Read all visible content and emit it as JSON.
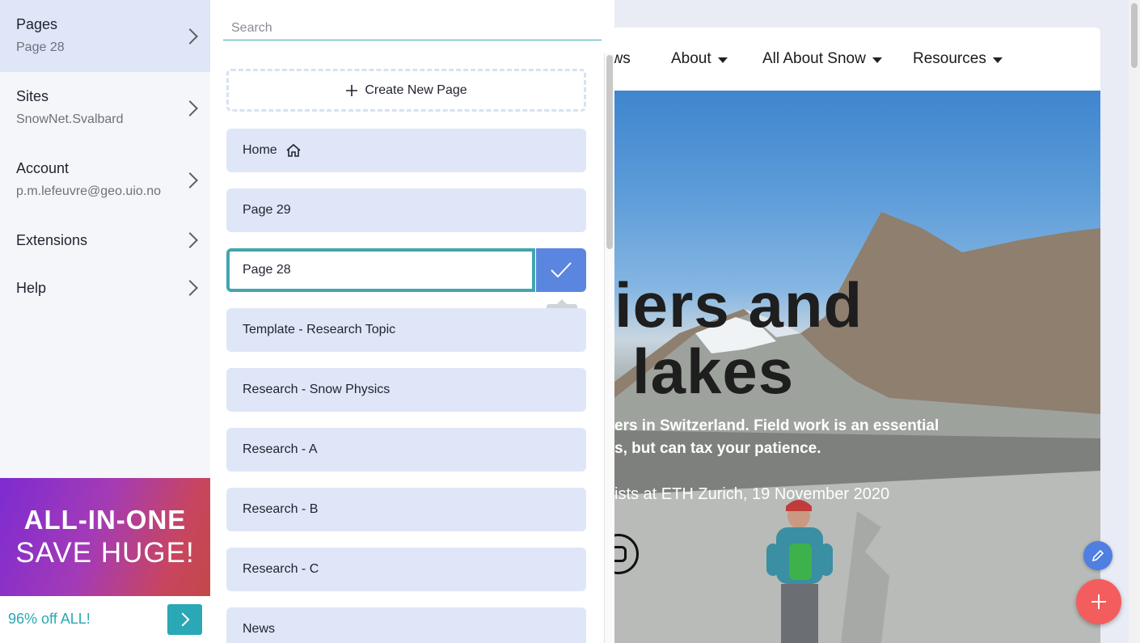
{
  "site": {
    "nav": [
      {
        "label": "ews"
      },
      {
        "label": "About"
      },
      {
        "label": "All About Snow"
      },
      {
        "label": "Resources"
      }
    ],
    "hero": {
      "title_line1": "iers and",
      "title_line2": "lakes",
      "subtitle_line1": "ers in Switzerland. Field work is an essential",
      "subtitle_line2": "s, but can tax your patience.",
      "credit": "ists at ETH Zurich, 19 November 2020"
    }
  },
  "left_nav": {
    "items": [
      {
        "title": "Pages",
        "subtitle": "Page 28"
      },
      {
        "title": "Sites",
        "subtitle": "SnowNet.Svalbard"
      },
      {
        "title": "Account",
        "subtitle": "p.m.lefeuvre@geo.uio.no"
      },
      {
        "title": "Extensions",
        "subtitle": ""
      },
      {
        "title": "Help",
        "subtitle": ""
      }
    ]
  },
  "ad": {
    "line1": "ALL-IN-ONE",
    "line2": "SAVE HUGE!",
    "footer_text": "96% off ALL!"
  },
  "pages_panel": {
    "search_placeholder": "Search",
    "create_label": "Create New Page",
    "pages": [
      {
        "label": "Home"
      },
      {
        "label": "Page 29"
      },
      {
        "label": "Page 28"
      },
      {
        "label": "Template - Research Topic"
      },
      {
        "label": "Research - Snow Physics"
      },
      {
        "label": "Research - A"
      },
      {
        "label": "Research - B"
      },
      {
        "label": "Research - C"
      },
      {
        "label": "News"
      }
    ],
    "rename_value": "Page 28",
    "ok_tooltip": "OK"
  },
  "colors": {
    "accent_teal": "#43a5ad",
    "accent_blue": "#5b86e0",
    "item_bg": "#dfe6f7",
    "fab_red": "#f35d5d"
  }
}
